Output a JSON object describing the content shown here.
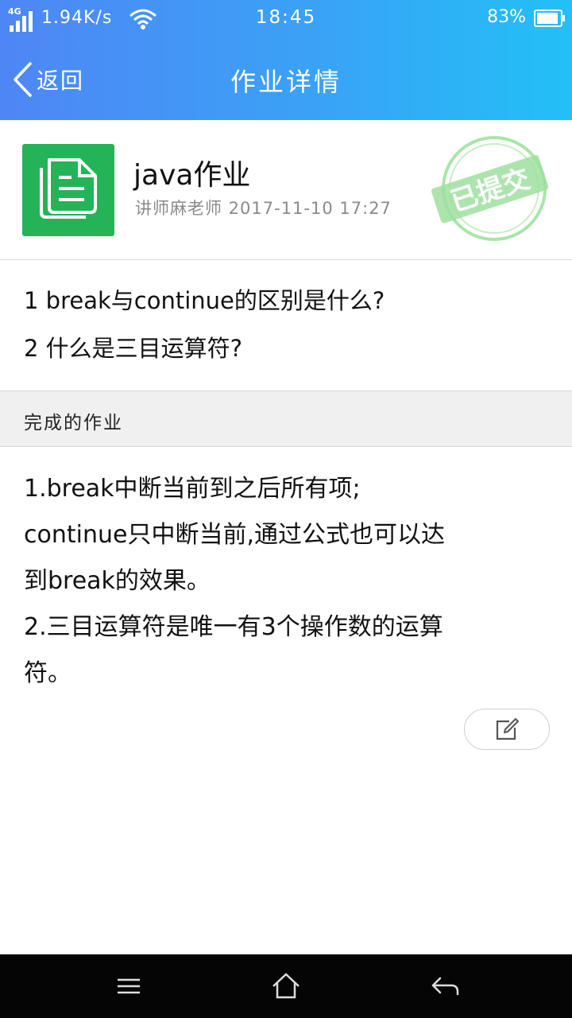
{
  "status_bar": {
    "network": "4G",
    "speed": "1.94K/s",
    "time": "18:45",
    "battery": "83%"
  },
  "nav": {
    "back_label": "返回",
    "title": "作业详情"
  },
  "homework": {
    "title": "java作业",
    "meta": "讲师麻老师 2017-11-10 17:27",
    "stamp": "已提交",
    "questions": [
      "1  break与continue的区别是什么?",
      "2  什么是三目运算符?"
    ]
  },
  "section": {
    "label": "完成的作业"
  },
  "answer": {
    "lines": [
      "1.break中断当前到之后所有项;",
      "  continue只中断当前,通过公式也可以达",
      "到break的效果。",
      "2.三目运算符是唯一有3个操作数的运算",
      "符。"
    ]
  },
  "colors": {
    "header_start": "#4f86f5",
    "header_end": "#22c0f7",
    "doc_icon_bg": "#25b358",
    "stamp": "#8fdc8f"
  },
  "icons": {
    "back": "chevron-left-icon",
    "doc": "document-icon",
    "edit": "edit-icon",
    "menu": "menu-icon",
    "home": "home-icon",
    "back_nav": "return-icon"
  }
}
